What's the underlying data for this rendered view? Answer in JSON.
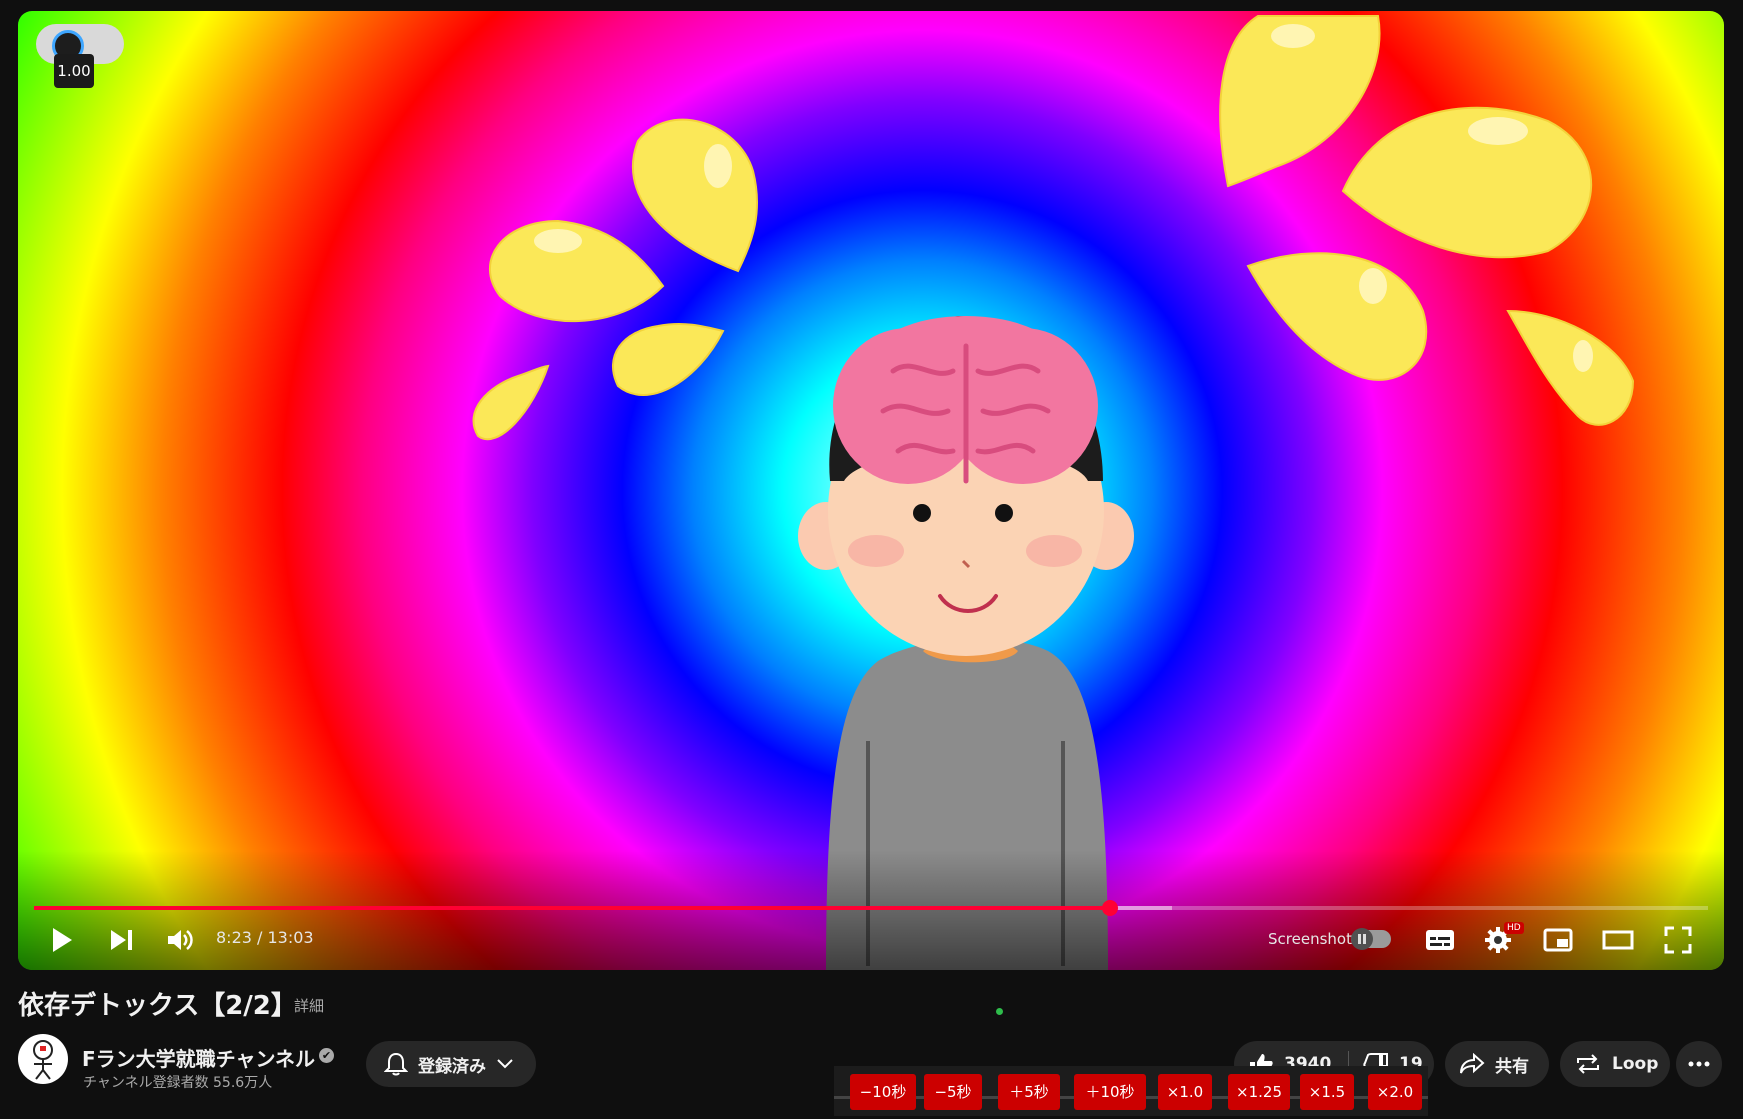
{
  "player": {
    "speed_indicator": "1.00",
    "time_display": "8:23 / 13:03",
    "progress_played": 0.643,
    "progress_loaded": 0.68,
    "screenshot_label": "Screenshot",
    "hd_badge": "HD"
  },
  "video": {
    "title": "依存デトックス【2/2】",
    "details_link": "詳細"
  },
  "channel": {
    "name": "Fラン大学就職チャンネル",
    "verified_mark": "✔",
    "subscribers": "チャンネル登録者数 55.6万人"
  },
  "actions": {
    "subscribe_label": "登録済み",
    "like_count": "3940",
    "dislike_count": "19",
    "share_label": "共有",
    "loop_label": "Loop"
  },
  "seek_buttons": [
    "−10秒",
    "−5秒",
    "＋5秒",
    "＋10秒",
    "×1.0",
    "×1.25",
    "×1.5",
    "×2.0"
  ],
  "colors": {
    "accent_red": "#ff0033",
    "button_red": "#cc0000",
    "background": "#0f0f0f"
  }
}
